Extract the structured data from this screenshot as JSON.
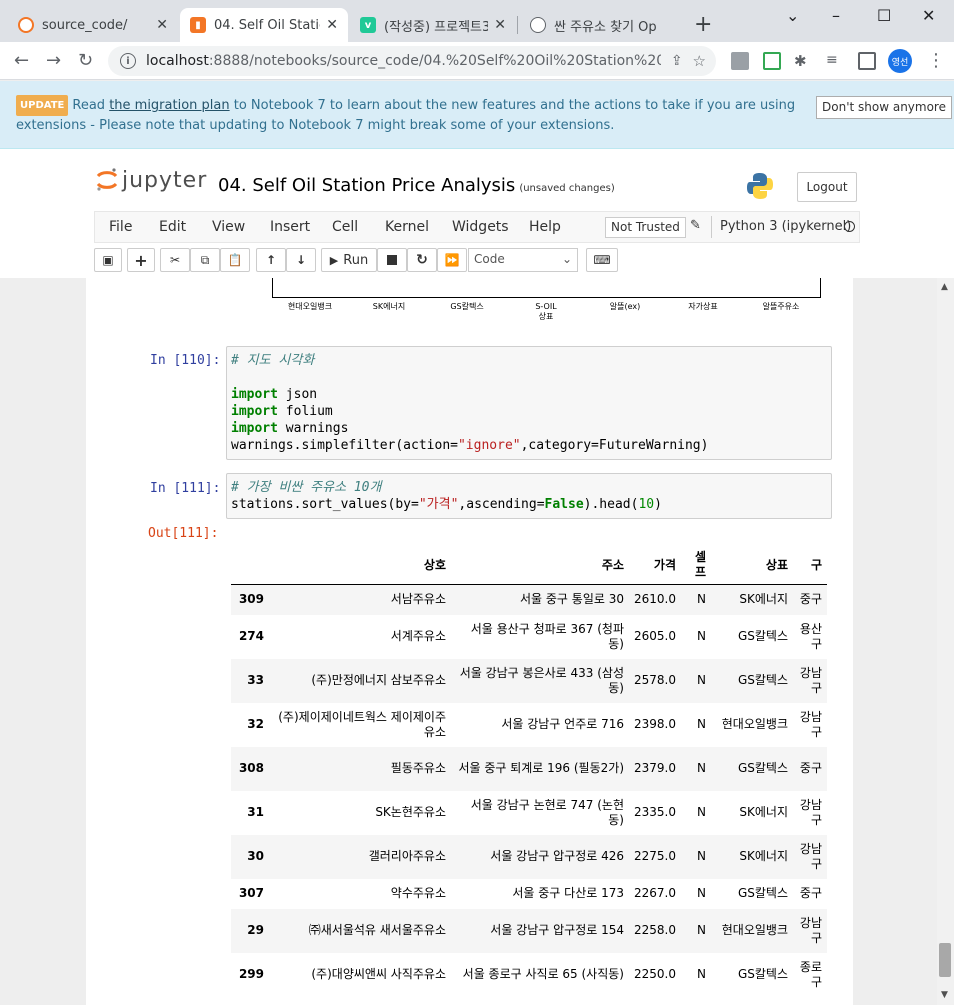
{
  "browser": {
    "tabs": [
      {
        "title": "source_code/",
        "close": "✕"
      },
      {
        "title": "04. Self Oil Station",
        "close": "✕"
      },
      {
        "title": "(작성중) 프로젝트3",
        "close": "✕"
      },
      {
        "title": "싼 주유소 찾기 Op",
        "close": ""
      }
    ],
    "new_tab": "+",
    "url_host": "localhost",
    "url_path": ":8888/notebooks/source_code/04.%20Self%20Oil%20Station%20Price...",
    "profile": "영선"
  },
  "banner": {
    "badge": "UPDATE",
    "text_before": "Read ",
    "link": "the migration plan",
    "text_after": " to Notebook 7 to learn about the new features and the actions to take if you are using extensions - Please note that updating to Notebook 7 might break some of your extensions.",
    "dont_show": "Don't show anymore"
  },
  "header": {
    "logo_text": "jupyter",
    "notebook_title": "04. Self Oil Station Price Analysis",
    "save_status": "(unsaved changes)",
    "logout": "Logout"
  },
  "menu": {
    "items": [
      "File",
      "Edit",
      "View",
      "Insert",
      "Cell",
      "Kernel",
      "Widgets",
      "Help"
    ],
    "not_trusted": "Not Trusted",
    "kernel": "Python 3 (ipykernel)"
  },
  "toolbar": {
    "run": "Run",
    "cell_type": "Code"
  },
  "plot_ticks": [
    "현대오일뱅크",
    "SK에너지",
    "GS칼텍스",
    "S-OIL\n상표",
    "알뜰(ex)",
    "자가상표",
    "알뜰주유소"
  ],
  "cells": {
    "c110": {
      "prompt": "In [110]:",
      "comment": "# 지도 시각화",
      "kw_import": "import",
      "mod1": " json",
      "mod2": " folium",
      "mod3": " warnings",
      "call_a": "warnings.simplefilter(action=",
      "str_ignore": "\"ignore\"",
      "call_b": ",category=FutureWarning)"
    },
    "c111": {
      "prompt": "In [111]:",
      "comment": "# 가장 비싼 주유소 10개",
      "call_a": "stations.sort_values(by=",
      "str_price": "\"가격\"",
      "call_b": ",ascending=",
      "kw_false": "False",
      "call_c": ").head(",
      "num": "10",
      "call_d": ")",
      "out_prompt": "Out[111]:"
    }
  },
  "table": {
    "columns": [
      "",
      "상호",
      "주소",
      "가격",
      "셀프",
      "상표",
      "구"
    ],
    "rows": [
      [
        "309",
        "서남주유소",
        "서울 중구 통일로 30",
        "2610.0",
        "N",
        "SK에너지",
        "중구"
      ],
      [
        "274",
        "서계주유소",
        "서울 용산구 청파로 367 (청파동)",
        "2605.0",
        "N",
        "GS칼텍스",
        "용산구"
      ],
      [
        "33",
        "(주)만정에너지 삼보주유소",
        "서울 강남구 봉은사로 433 (삼성동)",
        "2578.0",
        "N",
        "GS칼텍스",
        "강남구"
      ],
      [
        "32",
        "(주)제이제이네트웍스 제이제이주유소",
        "서울 강남구 언주로 716",
        "2398.0",
        "N",
        "현대오일뱅크",
        "강남구"
      ],
      [
        "308",
        "필동주유소",
        "서울 중구 퇴계로 196 (필동2가)",
        "2379.0",
        "N",
        "GS칼텍스",
        "중구"
      ],
      [
        "31",
        "SK논현주유소",
        "서울 강남구 논현로 747 (논현동)",
        "2335.0",
        "N",
        "SK에너지",
        "강남구"
      ],
      [
        "30",
        "갤러리아주유소",
        "서울 강남구 압구정로 426",
        "2275.0",
        "N",
        "SK에너지",
        "강남구"
      ],
      [
        "307",
        "약수주유소",
        "서울 중구 다산로 173",
        "2267.0",
        "N",
        "GS칼텍스",
        "중구"
      ],
      [
        "29",
        "㈜새서울석유 새서울주유소",
        "서울 강남구 압구정로 154",
        "2258.0",
        "N",
        "현대오일뱅크",
        "강남구"
      ],
      [
        "299",
        "(주)대양씨앤씨 사직주유소",
        "서울 종로구 사직로 65 (사직동)",
        "2250.0",
        "N",
        "GS칼텍스",
        "종로구"
      ]
    ]
  }
}
